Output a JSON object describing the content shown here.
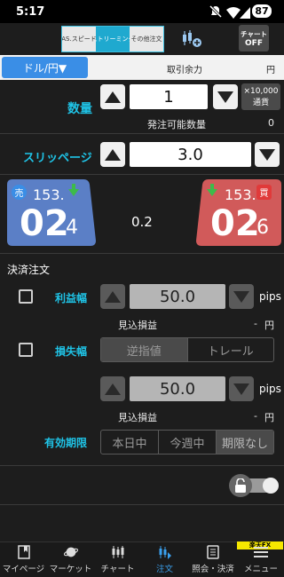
{
  "status_bar": {
    "time": "5:17",
    "battery": "87"
  },
  "header": {
    "tabs": [
      "AS.スピード",
      "ストリーミング",
      "その他注文"
    ],
    "chart_toggle": {
      "line1": "チャート",
      "line2": "OFF"
    }
  },
  "pair_row": {
    "pair": "ドル/円▼",
    "margin_label": "取引余力",
    "margin_unit": "円"
  },
  "quantity": {
    "label": "数量",
    "value": "1",
    "unit_line1": "×10,000",
    "unit_line2": "通貨",
    "orderable_label": "発注可能数量",
    "orderable_value": "0"
  },
  "slippage": {
    "label": "スリッページ",
    "value": "3.0"
  },
  "sell": {
    "badge": "売",
    "prefix": "153.",
    "big": "02",
    "small": "4"
  },
  "buy": {
    "badge": "買",
    "prefix": "153.",
    "big": "02",
    "small": "6"
  },
  "spread": "0.2",
  "settlement": {
    "title": "決済注文",
    "profit": {
      "label": "利益幅",
      "value": "50.0",
      "unit": "pips",
      "est_label": "見込損益",
      "est_value": "-",
      "est_unit": "円"
    },
    "loss": {
      "label": "損失幅",
      "mode_options": [
        "逆指値",
        "トレール"
      ],
      "value": "50.0",
      "unit": "pips",
      "est_label": "見込損益",
      "est_value": "-",
      "est_unit": "円"
    },
    "expiry": {
      "label": "有効期限",
      "options": [
        "本日中",
        "今週中",
        "期限なし"
      ]
    }
  },
  "bottom_nav": {
    "brand": "楽天FX",
    "items": [
      "マイページ",
      "マーケット",
      "チャート",
      "注文",
      "照会・決済",
      "メニュー"
    ],
    "active_index": 3
  },
  "colors": {
    "accent": "#1fc3e6",
    "sell": "#5b7fc6",
    "buy": "#d15a5a",
    "primary_button": "#3a8ee6"
  }
}
